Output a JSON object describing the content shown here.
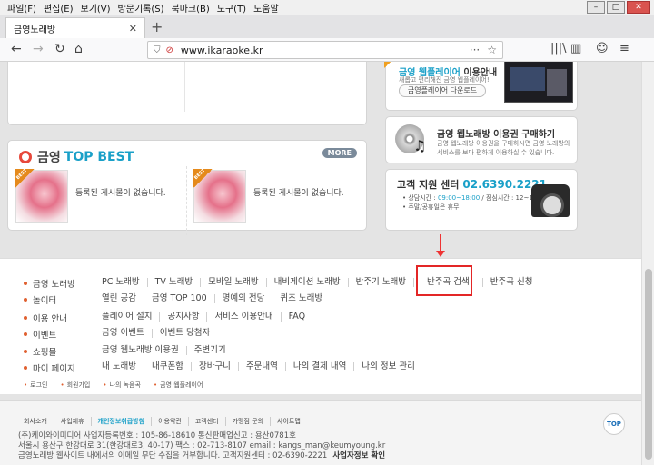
{
  "browser": {
    "menu": [
      "파일(F)",
      "편집(E)",
      "보기(V)",
      "방문기록(S)",
      "북마크(B)",
      "도구(T)",
      "도움말"
    ],
    "window_controls": [
      "–",
      "□",
      "✕"
    ],
    "tab_title": "금영노래방",
    "tab_close": "✕",
    "new_tab": "+",
    "url": "www.ikaraoke.kr",
    "back": "←",
    "forward": "→",
    "reload": "↻",
    "home": "⌂",
    "tracking_icon": "⛉",
    "no_autoplay_icon": "⊘",
    "url_more": "···",
    "bookmark_star": "☆",
    "library": "|||\\",
    "sidebar_toggle": "▥",
    "account": "☺",
    "app_menu": "≡"
  },
  "top_best": {
    "title_a": "금영",
    "title_b": "TOP BEST",
    "more": "MORE",
    "badge": "BEST",
    "empty_text_1": "등록된 게시물이 없습니다.",
    "empty_text_2": "등록된 게시물이 없습니다."
  },
  "web_player": {
    "title_hl": "금영 웹플레이어",
    "title_rest": " 이용안내",
    "sub": "새롭고 편리해진 금영 웹플레이어!",
    "button": "금영플레이어 다운로드"
  },
  "web_karaoke": {
    "title": "금영 웹노래방  이용권 구매하기",
    "sub_1": "금영 웹노래방 이용권을 구매하시면 금영 노래방의",
    "sub_2": "서비스를 보다 편하게 이용하실 수 있습니다."
  },
  "support": {
    "title": "고객 지원 센터",
    "phone": "02.6390.2221",
    "hours_label": "상담시간 : ",
    "hours": "09:00~18:00",
    "lunch": " / 점심시간 : 12~13",
    "holiday": "주말/공휴일은 휴무"
  },
  "sitemap": {
    "categories": [
      {
        "label": "금영 노래방",
        "links": [
          "PC 노래방",
          "TV 노래방",
          "모바일 노래방",
          "내비게이션 노래방",
          "반주기 노래방",
          "반주곡 검색",
          "반주곡 신청"
        ]
      },
      {
        "label": "놀이터",
        "links": [
          "열린 공감",
          "금영 TOP 100",
          "명예의 전당",
          "퀴즈 노래방"
        ]
      },
      {
        "label": "이용 안내",
        "links": [
          "플레이어 설치",
          "공지사항",
          "서비스 이용안내",
          "FAQ"
        ]
      },
      {
        "label": "이벤트",
        "links": [
          "금영 이벤트",
          "이벤트 당첨자"
        ]
      },
      {
        "label": "쇼핑몰",
        "links": [
          "금영 웹노래방 이용권",
          "주변기기"
        ]
      },
      {
        "label": "마이 페이지",
        "links": [
          "내 노래방",
          "내쿠폰함",
          "장바구니",
          "주문내역",
          "나의 결제 내역",
          "나의 정보 관리"
        ]
      }
    ],
    "bottom_links": [
      "로그인",
      "회원가입",
      "나의 녹음곡",
      "금영 웹플레이어"
    ]
  },
  "footer": {
    "nav": [
      "회사소개",
      "사업제휴",
      "개인정보취급방침",
      "이용약관",
      "고객센터",
      "가맹점 문의",
      "사이트맵"
    ],
    "line_1": "(주)케이와이미디어   사업자등록번호 : 105-86-18610   통신판매업신고 : 용산0781호",
    "line_2": "서울시 용산구 한강대로 31(한강대로3, 40-17)   팩스 : 02-713-8107   email : kangs_man@keumyoung.kr",
    "line_3": "금영노래방 웹사이트 내에서의 이메일 무단 수집을 거부합니다.   고객지원센터 : 02-6390-2221",
    "biz_info": "사업자정보 확인",
    "top_button": "TOP"
  }
}
